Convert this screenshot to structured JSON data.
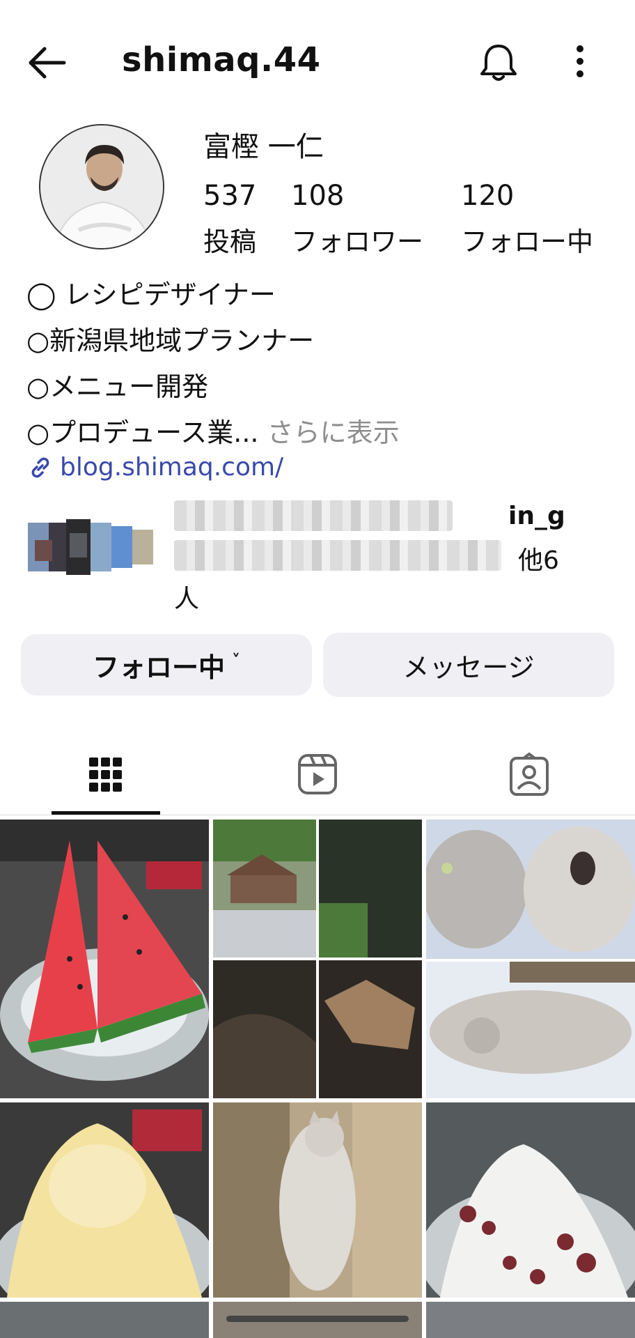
{
  "header": {
    "back_icon": "arrow-left-icon",
    "username": "shimaq.44",
    "bell_icon": "bell-icon",
    "more_icon": "more-vertical-icon"
  },
  "profile": {
    "name": "富樫 一仁",
    "stats": [
      {
        "value": "537",
        "label": "投稿"
      },
      {
        "value": "108",
        "label": "フォロワー"
      },
      {
        "value": "120",
        "label": "フォロー中"
      }
    ],
    "bio_lines": [
      "◯ レシピデザイナー",
      "○新潟県地域プランナー",
      "○メニュー開発",
      "○プロデュース業..."
    ],
    "bio_more": "さらに表示",
    "link_icon": "link-icon",
    "link_text": "blog.shimaq.com/"
  },
  "mutual": {
    "suffix1": "in_g",
    "suffix2": "他6",
    "suffix3": "人"
  },
  "actions": {
    "follow_label": "フォロー中",
    "chevron": "˅",
    "message_label": "メッセージ"
  },
  "tabs": [
    {
      "icon": "grid-icon"
    },
    {
      "icon": "reels-icon"
    },
    {
      "icon": "tagged-icon"
    }
  ],
  "colors": {
    "link": "#3949ab",
    "button_bg": "#efeff4",
    "muted": "#8e8e8e"
  }
}
